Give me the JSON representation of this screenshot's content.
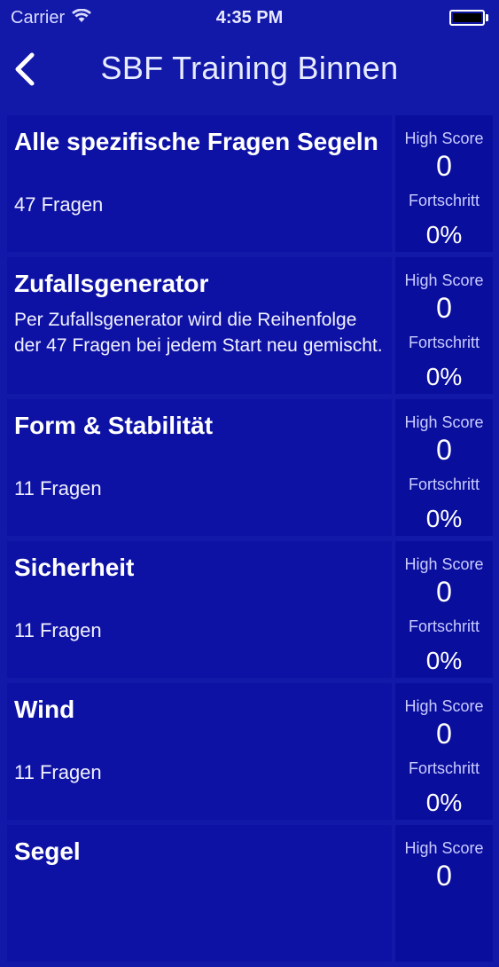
{
  "status": {
    "carrier": "Carrier",
    "time": "4:35 PM"
  },
  "nav": {
    "title": "SBF Training Binnen"
  },
  "stat_labels": {
    "high_score": "High Score",
    "progress": "Fortschritt"
  },
  "rows": [
    {
      "title": "Alle spezifische Fragen Segeln",
      "subtitle": "47 Fragen",
      "high_score": "0",
      "progress": "0%"
    },
    {
      "title": "Zufallsgenerator",
      "description": "Per Zufallsgenerator wird die Reihenfolge der 47 Fragen bei jedem Start neu gemischt.",
      "high_score": "0",
      "progress": "0%"
    },
    {
      "title": "Form & Stabilität",
      "subtitle": "11 Fragen",
      "high_score": "0",
      "progress": "0%"
    },
    {
      "title": "Sicherheit",
      "subtitle": "11 Fragen",
      "high_score": "0",
      "progress": "0%"
    },
    {
      "title": "Wind",
      "subtitle": "11 Fragen",
      "high_score": "0",
      "progress": "0%"
    },
    {
      "title": "Segel",
      "high_score": "0"
    }
  ]
}
